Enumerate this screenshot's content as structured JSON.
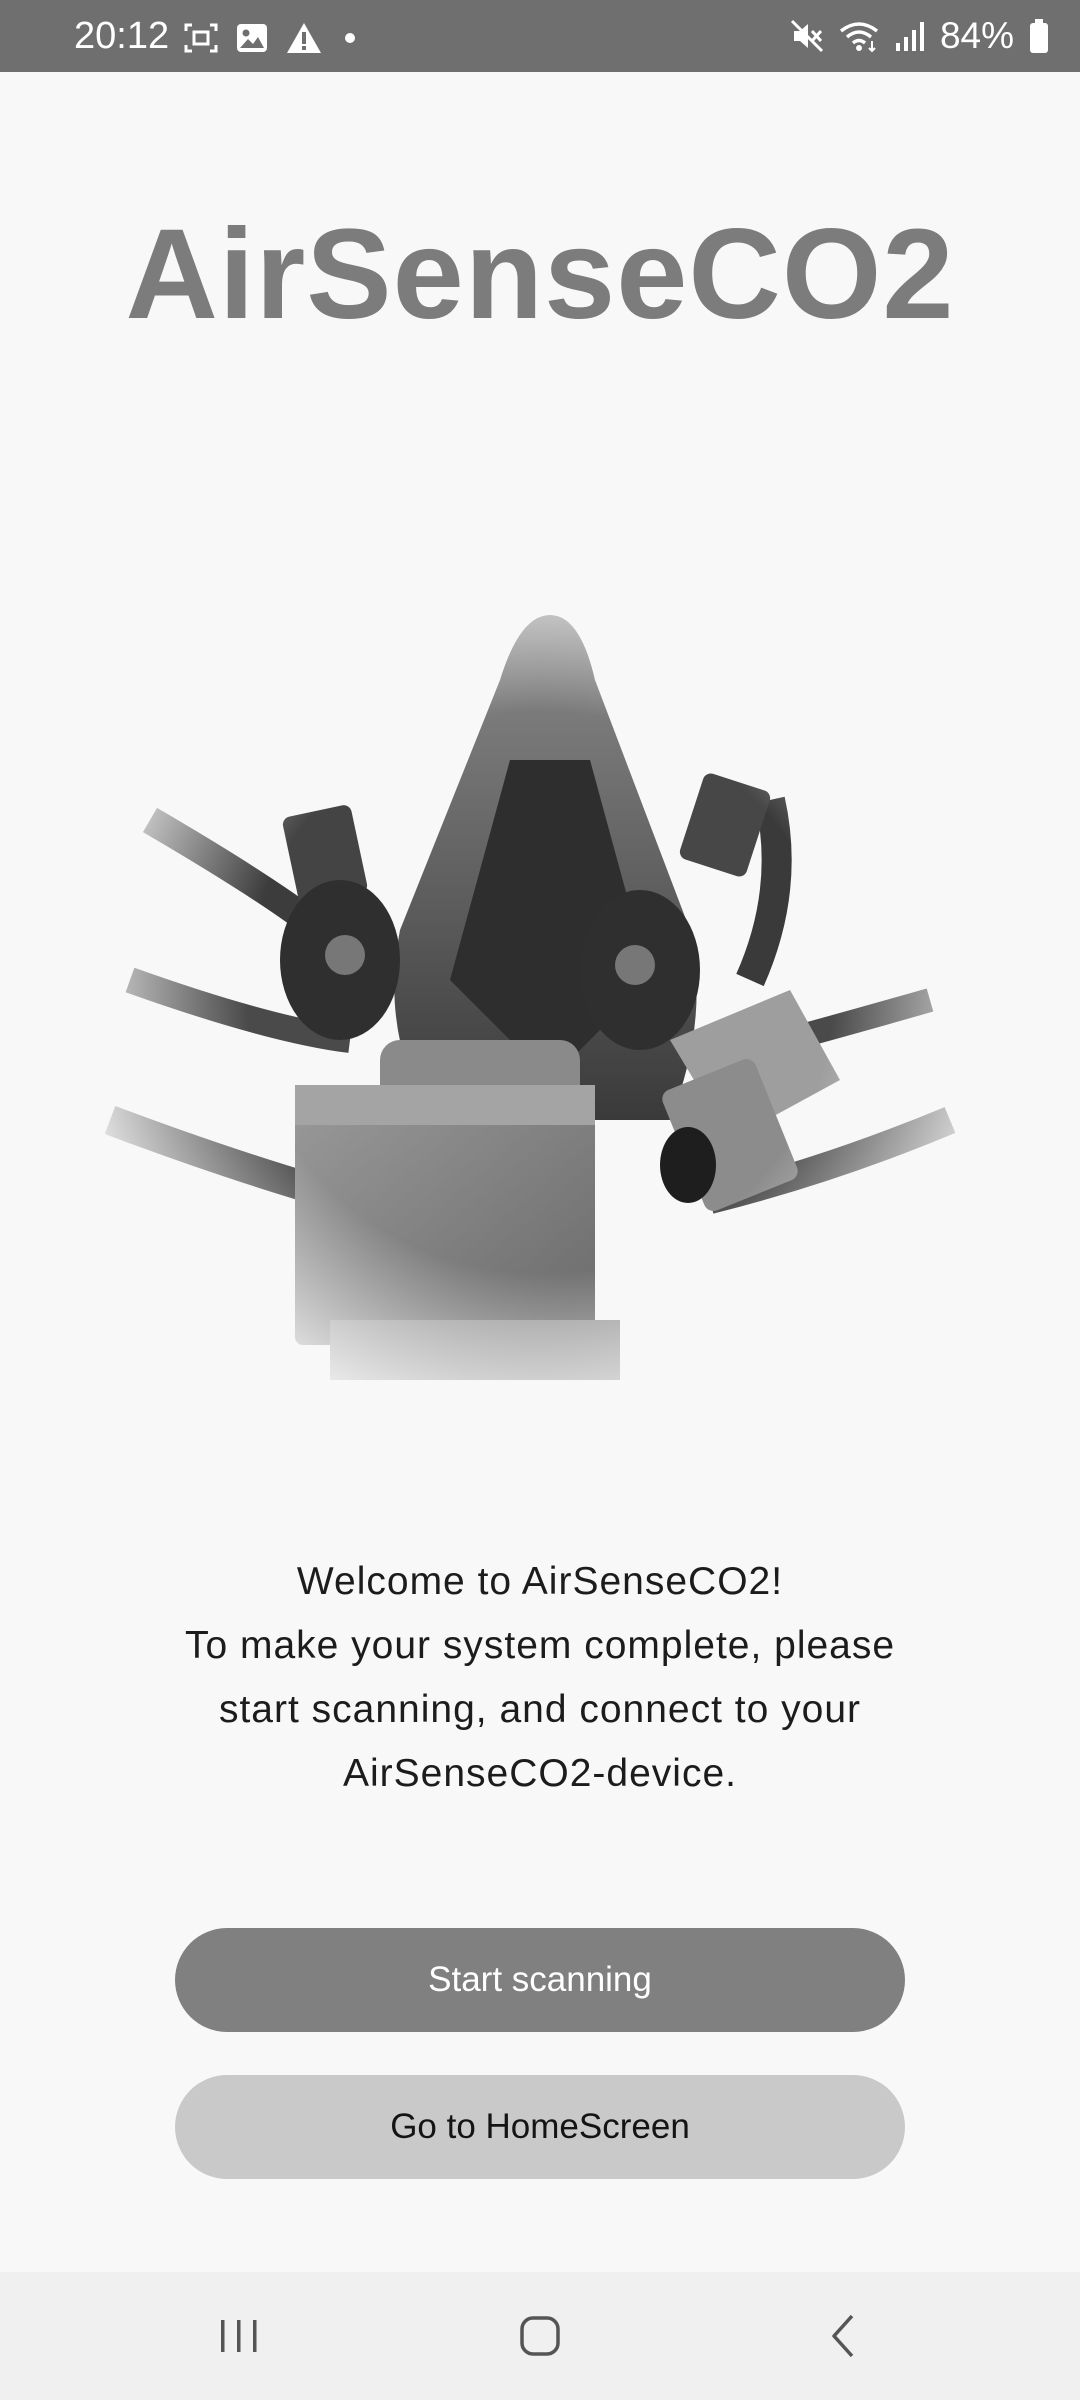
{
  "status_bar": {
    "time": "20:12",
    "left_icons": [
      "screenshot-icon",
      "gallery-icon",
      "warning-icon",
      "dot-icon"
    ],
    "right_icons": [
      "mute-icon",
      "wifi-icon",
      "signal-icon"
    ],
    "battery_percent": "84%",
    "battery_icon": "battery-icon"
  },
  "app": {
    "title": "AirSenseCO2",
    "hero_image": "respirator-mask-with-sensor-photo"
  },
  "welcome": {
    "lines": [
      "Welcome to AirSenseCO2!",
      "To make your system complete, please",
      "start scanning, and connect to your",
      "AirSenseCO2-device."
    ]
  },
  "buttons": {
    "start_scanning": "Start scanning",
    "go_home": "Go to HomeScreen"
  },
  "nav_bar": {
    "icons": [
      "recents-icon",
      "home-icon",
      "back-icon"
    ]
  },
  "colors": {
    "status_bar_bg": "#6f6f6f",
    "title": "#7c7c7c",
    "primary_button": "#808080",
    "secondary_button": "#c9c9c9",
    "background": "#f8f8f8"
  }
}
